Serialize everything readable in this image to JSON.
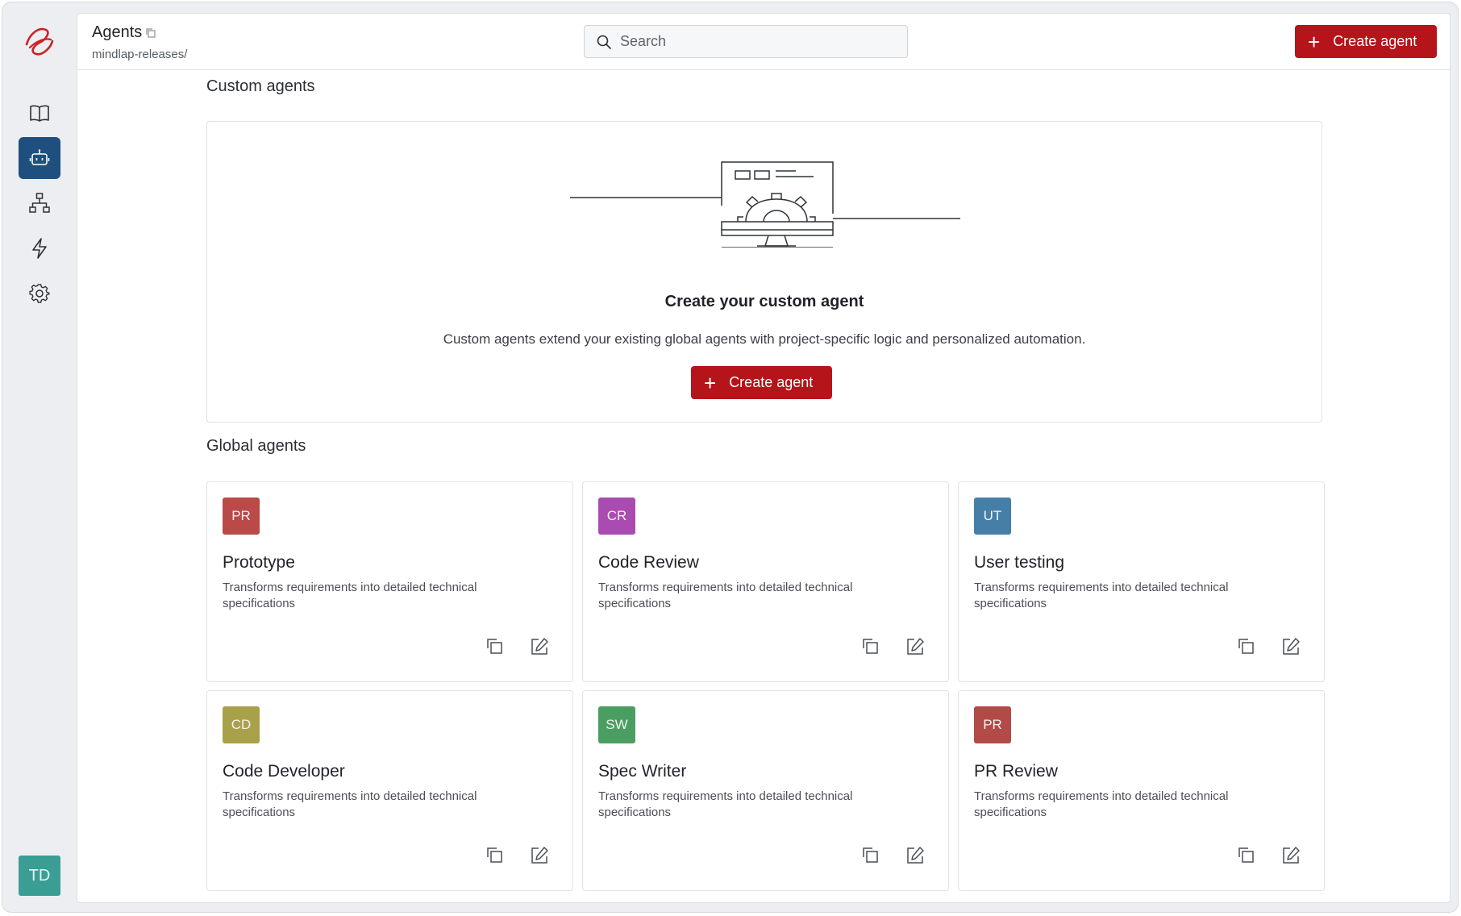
{
  "header": {
    "title": "Agents",
    "subtitle": "mindlap-releases/",
    "create_label": "Create agent"
  },
  "search": {
    "placeholder": "Search"
  },
  "sidebar": {
    "items": [
      {
        "name": "docs",
        "icon": "book-icon"
      },
      {
        "name": "agents",
        "icon": "bot-icon",
        "active": true
      },
      {
        "name": "workflows",
        "icon": "hierarchy-icon"
      },
      {
        "name": "actions",
        "icon": "lightning-icon"
      },
      {
        "name": "settings",
        "icon": "gear-icon"
      }
    ],
    "user_initials": "TD"
  },
  "custom_agents": {
    "heading": "Custom agents",
    "empty_title": "Create your custom agent",
    "empty_description": "Custom agents extend your existing global agents with project-specific logic and personalized automation.",
    "create_label": "Create agent"
  },
  "global_agents": {
    "heading": "Global agents",
    "agents": [
      {
        "initials": "PR",
        "name": "Prototype",
        "description": "Transforms requirements into detailed technical specifications",
        "color": "#b94a48"
      },
      {
        "initials": "CR",
        "name": "Code Review",
        "description": "Transforms requirements into detailed technical specifications",
        "color": "#a94bb0"
      },
      {
        "initials": "UT",
        "name": "User testing",
        "description": "Transforms requirements into detailed technical specifications",
        "color": "#457fa8"
      },
      {
        "initials": "CD",
        "name": "Code Developer",
        "description": "Transforms requirements into detailed technical specifications",
        "color": "#a9a04a"
      },
      {
        "initials": "SW",
        "name": "Spec Writer",
        "description": "Transforms requirements into detailed technical specifications",
        "color": "#4a9e62"
      },
      {
        "initials": "PR",
        "name": "PR Review",
        "description": "Transforms requirements into detailed technical specifications",
        "color": "#b24a48"
      }
    ]
  },
  "colors": {
    "accent": "#b4141a",
    "sidebar_active": "#1f4f7e",
    "avatar": "#3a9e95"
  }
}
